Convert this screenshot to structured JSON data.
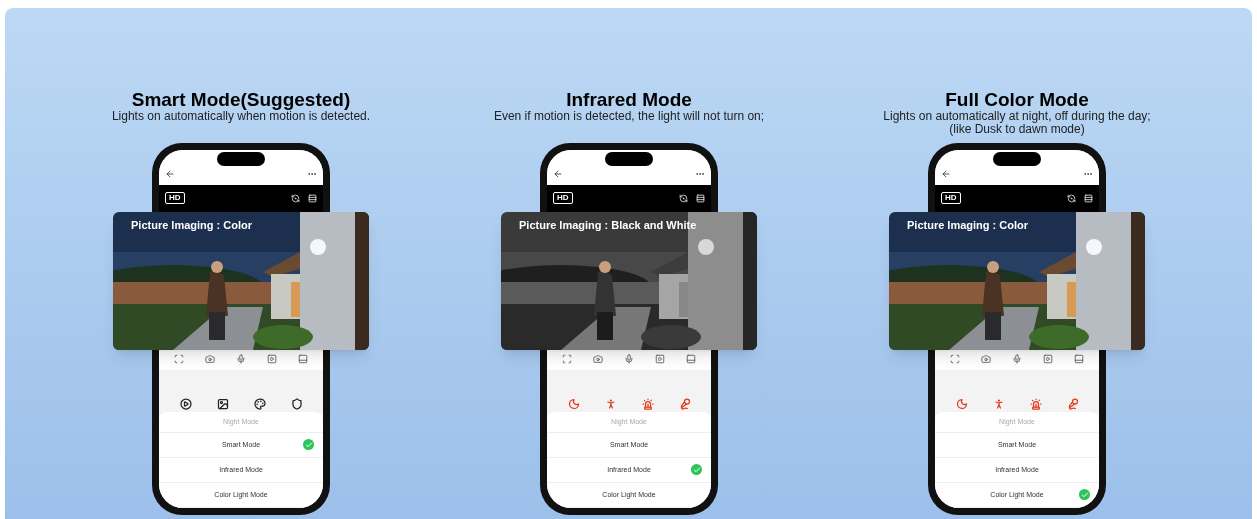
{
  "panels": [
    {
      "title": "Smart Mode(Suggested)",
      "subtitle": [
        "Lights on automatically when motion is detected."
      ],
      "badge": "HD",
      "photo": {
        "kind": "color",
        "caption": "Picture Imaging : Color"
      },
      "quick_icons": {
        "kind": "media"
      },
      "sheet_title": "Night Mode",
      "modes": [
        {
          "label": "Smart Mode",
          "selected": true
        },
        {
          "label": "Infrared Mode",
          "selected": false
        },
        {
          "label": "Color Light Mode",
          "selected": false
        }
      ]
    },
    {
      "title": "Infrared Mode",
      "subtitle": [
        "Even if motion is detected, the light will not turn on;"
      ],
      "badge": "HD",
      "photo": {
        "kind": "mono",
        "caption": "Picture Imaging : Black and White"
      },
      "quick_icons": {
        "kind": "alerts"
      },
      "sheet_title": "Night Mode",
      "modes": [
        {
          "label": "Smart Mode",
          "selected": false
        },
        {
          "label": "Infrared Mode",
          "selected": true
        },
        {
          "label": "Color Light Mode",
          "selected": false
        }
      ]
    },
    {
      "title": "Full Color Mode",
      "subtitle": [
        "Lights on automatically at night, off during the day;",
        "(like Dusk to dawn mode)"
      ],
      "badge": "HD",
      "photo": {
        "kind": "color",
        "caption": "Picture Imaging : Color"
      },
      "quick_icons": {
        "kind": "alerts"
      },
      "sheet_title": "Night Mode",
      "modes": [
        {
          "label": "Smart Mode",
          "selected": false
        },
        {
          "label": "Infrared Mode",
          "selected": false
        },
        {
          "label": "Color Light Mode",
          "selected": true
        }
      ]
    }
  ]
}
